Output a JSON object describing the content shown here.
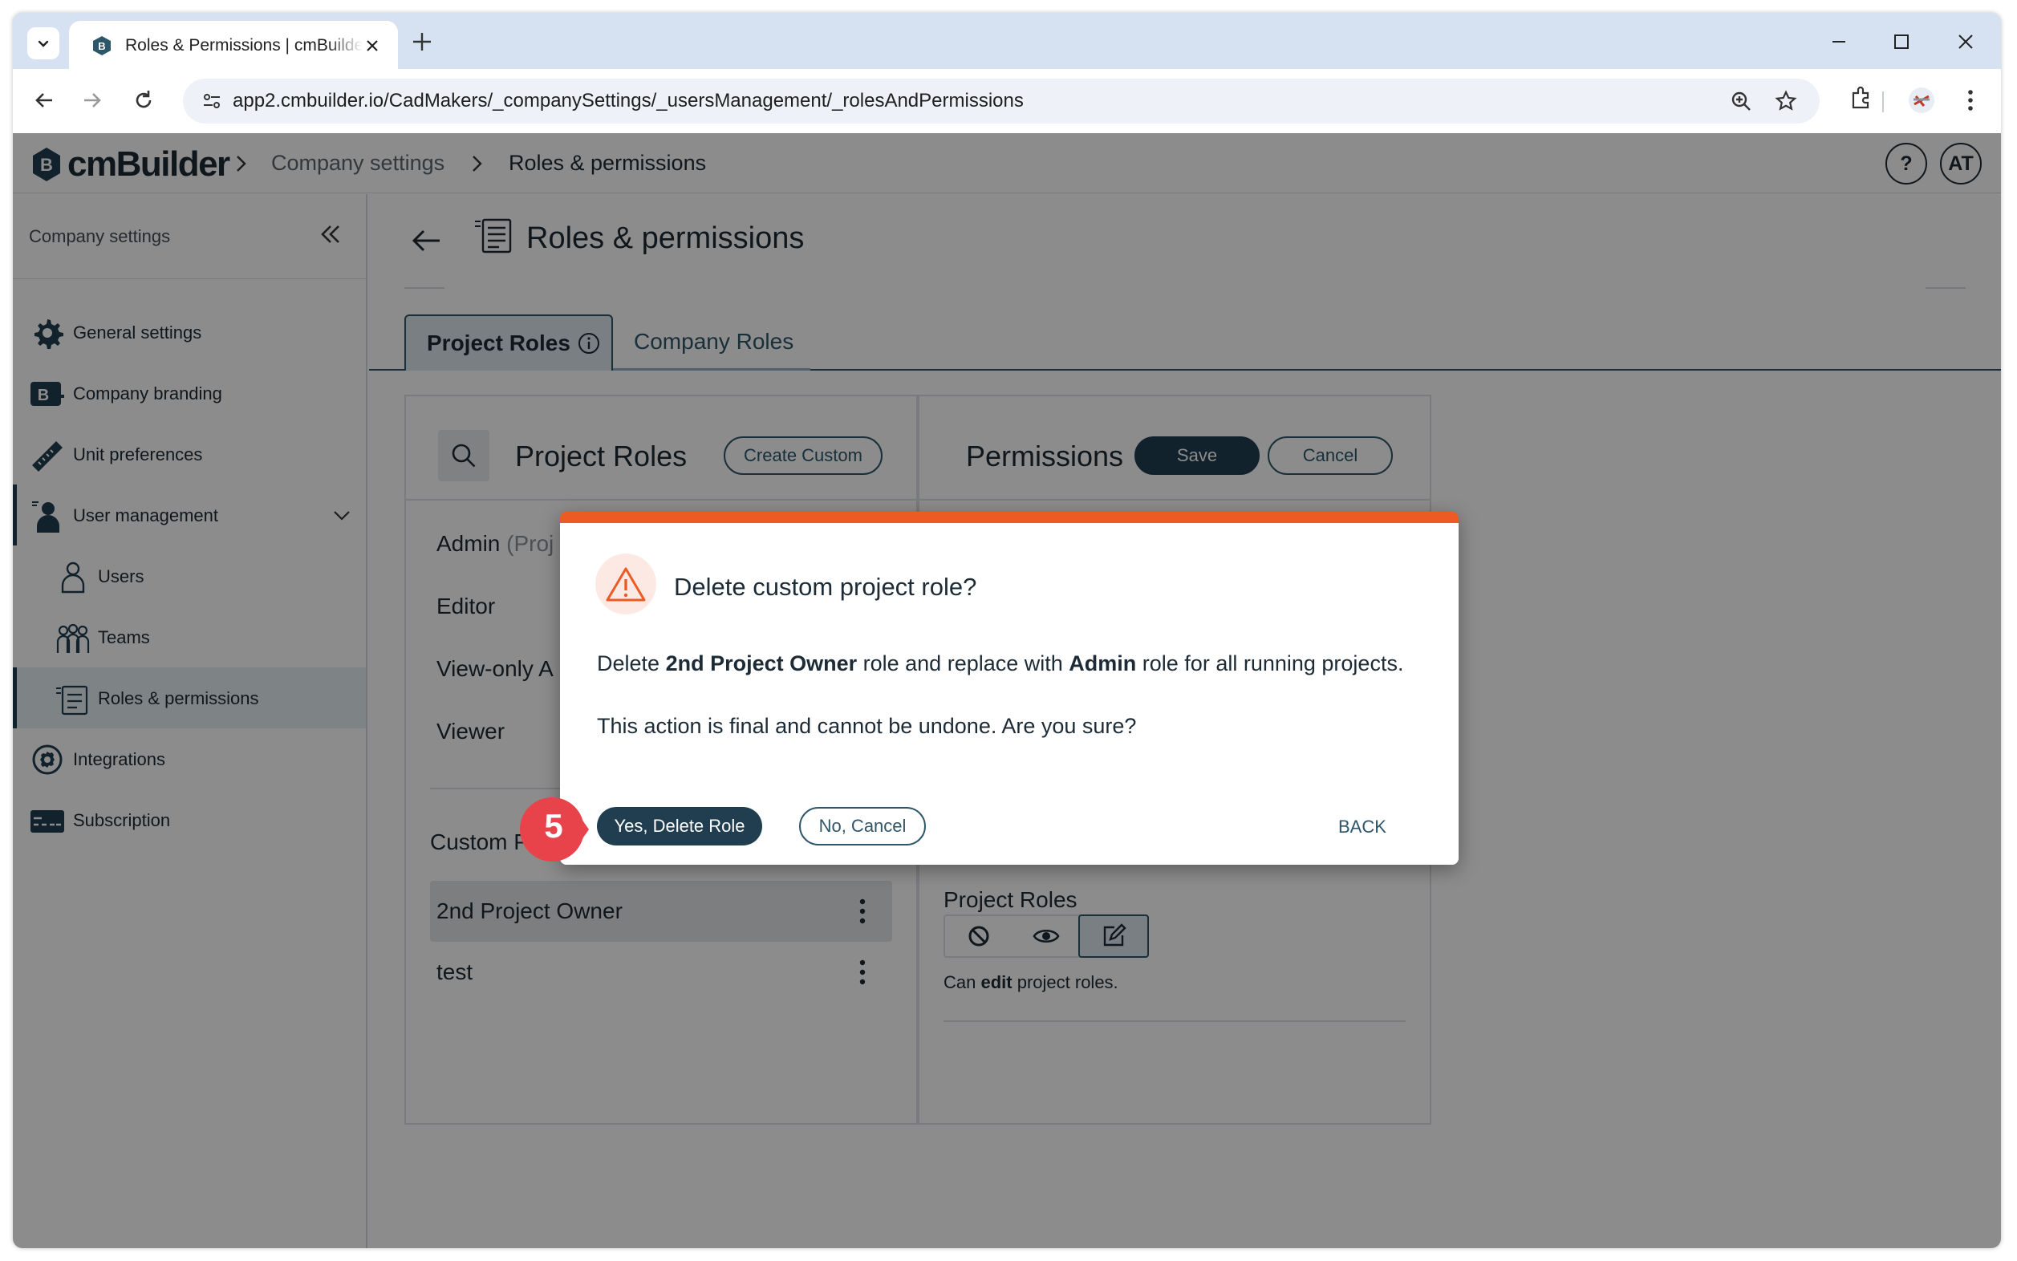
{
  "browser": {
    "tab_title": "Roles & Permissions | cmBuilder",
    "url": "app2.cmbuilder.io/CadMakers/_companySettings/_usersManagement/_rolesAndPermissions"
  },
  "app": {
    "logo_text": "cmBuilder",
    "breadcrumb": [
      "Company settings",
      "Roles & permissions"
    ],
    "help_label": "?",
    "avatar_initials": "AT"
  },
  "sidebar": {
    "header": "Company settings",
    "items": [
      {
        "label": "General settings",
        "icon": "gear-icon"
      },
      {
        "label": "Company branding",
        "icon": "branding-icon"
      },
      {
        "label": "Unit preferences",
        "icon": "ruler-icon"
      },
      {
        "label": "User management",
        "icon": "user-management-icon"
      },
      {
        "label": "Users",
        "icon": "user-icon"
      },
      {
        "label": "Teams",
        "icon": "teams-icon"
      },
      {
        "label": "Roles & permissions",
        "icon": "roles-icon"
      },
      {
        "label": "Integrations",
        "icon": "integrations-icon"
      },
      {
        "label": "Subscription",
        "icon": "credit-card-icon"
      }
    ]
  },
  "main": {
    "page_title": "Roles & permissions",
    "tabs": [
      {
        "label": "Project Roles",
        "active": true
      },
      {
        "label": "Company Roles",
        "active": false
      }
    ],
    "roles_panel": {
      "title": "Project Roles",
      "create_label": "Create Custom",
      "default_roles": [
        {
          "name": "Admin",
          "suffix": "(Proj"
        },
        {
          "name": "Editor"
        },
        {
          "name": "View-only A"
        },
        {
          "name": "Viewer"
        }
      ],
      "custom_header": "Custom Proje",
      "custom_roles": [
        "2nd Project Owner",
        "test"
      ]
    },
    "permissions_panel": {
      "title": "Permissions",
      "save_label": "Save",
      "cancel_label": "Cancel",
      "section_title": "Project Roles",
      "desc_prefix": "Can ",
      "desc_bold": "edit",
      "desc_suffix": " project roles."
    }
  },
  "dialog": {
    "title": "Delete custom project role?",
    "message_parts": [
      "Delete ",
      "2nd Project Owner",
      " role and replace with ",
      "Admin",
      " role for all running projects."
    ],
    "message2": "This action is final and cannot be undone. Are you sure?",
    "confirm_label": "Yes, Delete Role",
    "cancel_label": "No, Cancel",
    "back_label": "BACK"
  },
  "callout": {
    "step_number": "5",
    "color": "#e8424a"
  },
  "colors": {
    "primary": "#213e50",
    "warning": "#ec5b24"
  }
}
